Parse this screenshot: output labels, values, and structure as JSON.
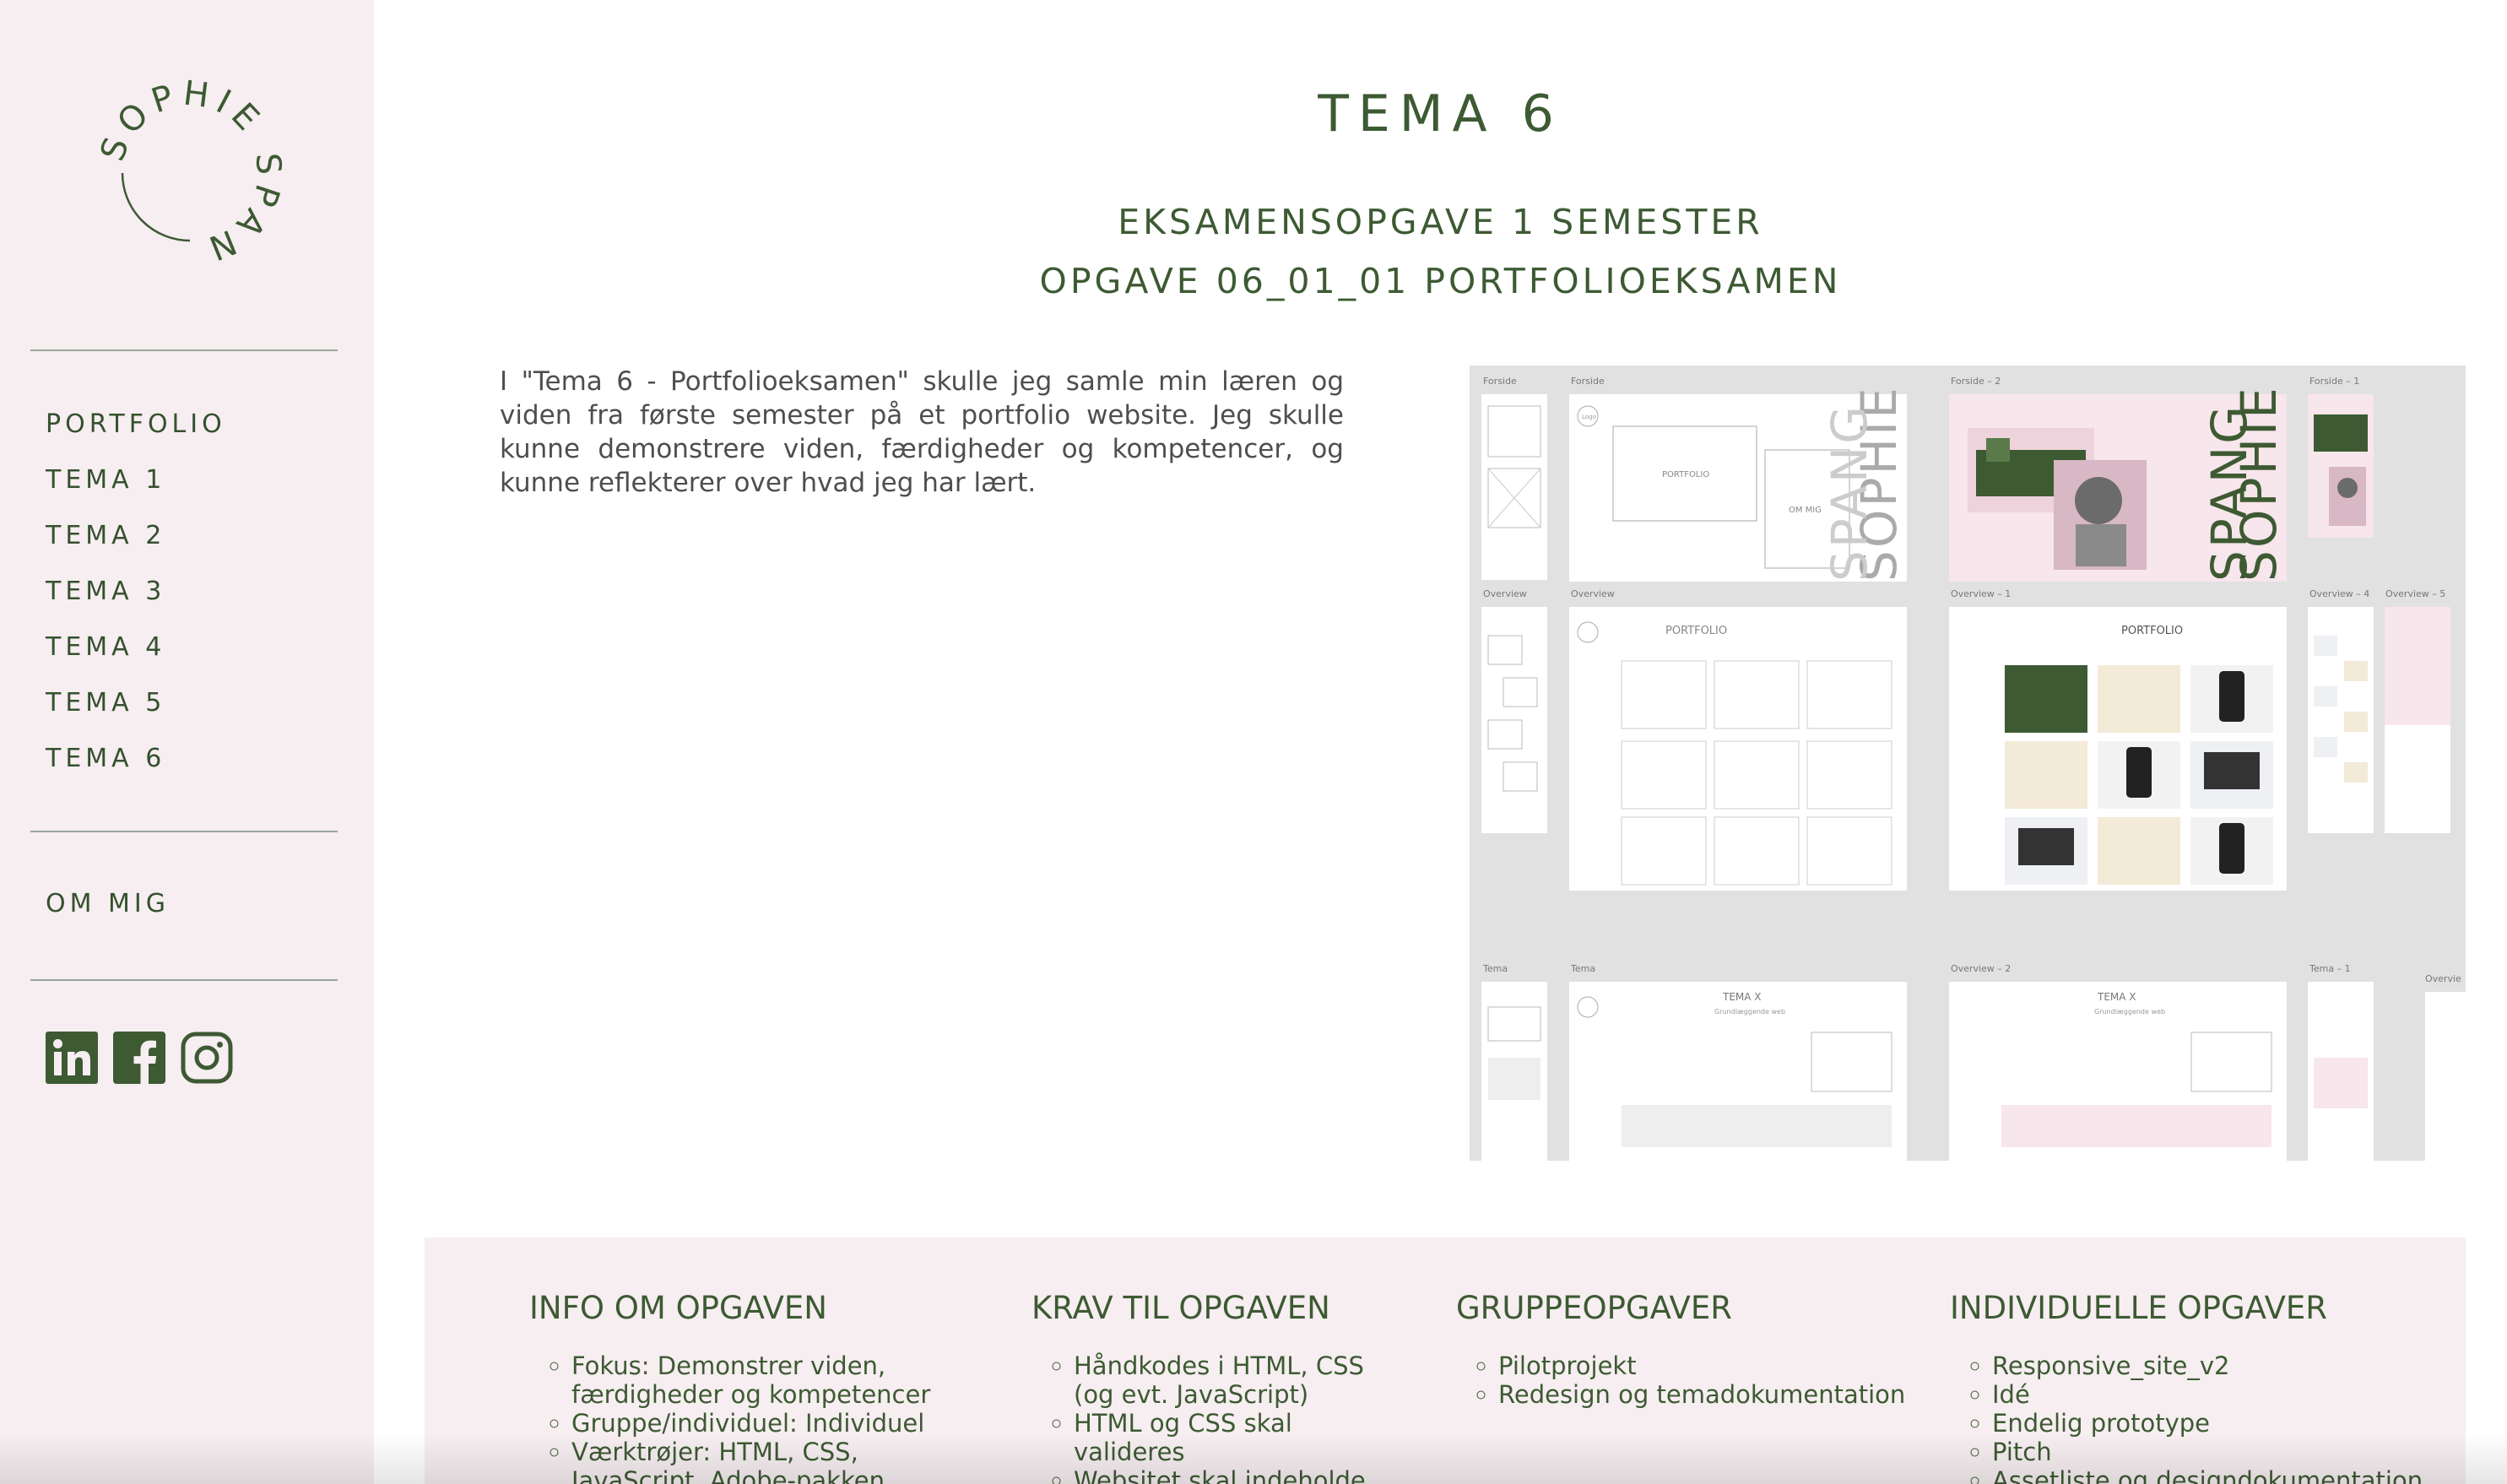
{
  "brand": {
    "name": "SOPHIE SPANG",
    "first": "SOPHIE",
    "last": "SPANG",
    "accent": "#3d5a33",
    "sidebar_bg": "#f6eef0"
  },
  "nav": {
    "items": [
      {
        "label": "PORTFOLIO"
      },
      {
        "label": "TEMA 1"
      },
      {
        "label": "TEMA 2"
      },
      {
        "label": "TEMA 3"
      },
      {
        "label": "TEMA 4"
      },
      {
        "label": "TEMA 5"
      },
      {
        "label": "TEMA 6"
      }
    ],
    "about": "OM MIG"
  },
  "social": [
    {
      "icon": "linkedin-icon"
    },
    {
      "icon": "facebook-icon"
    },
    {
      "icon": "instagram-icon"
    }
  ],
  "page": {
    "title": "TEMA 6",
    "subtitle1": "EKSAMENSOPGAVE 1 SEMESTER",
    "subtitle2": "OPGAVE 06_01_01 PORTFOLIOEKSAMEN",
    "intro": "I \"Tema 6 - Portfolioeksamen\" skulle jeg samle min læren og viden fra første semester på et portfolio website. Jeg skulle kunne demonstrere viden, færdigheder og kompetencer, og kunne reflekterer over hvad jeg har lært."
  },
  "mockup": {
    "frame_labels": [
      "Forside",
      "Forside",
      "Forside – 2",
      "Forside – 1",
      "Overview",
      "Overview",
      "Overview – 1",
      "Overview – 4",
      "Overview – 5",
      "Tema",
      "Tema",
      "Overview – 2",
      "Tema – 1",
      "Overvie"
    ],
    "texts": {
      "portfolio": "PORTFOLIO",
      "om_mig": "OM MIG",
      "logo": "Logo",
      "tema_x": "TEMA X",
      "tema_x_sub": "Grundlæggende web",
      "vertical_a": "SOPHIE",
      "vertical_b": "SPANG"
    }
  },
  "info": {
    "columns": [
      {
        "heading": "INFO OM OPGAVEN",
        "items": [
          "Fokus: Demonstrer viden, færdigheder og kompetencer",
          "Gruppe/individuel: Individuel",
          "Værktrøjer: HTML, CSS, JavaScript, Adobe-pakken"
        ]
      },
      {
        "heading": "KRAV TIL OPGAVEN",
        "items": [
          "Håndkodes i HTML, CSS (og evt. JavaScript)",
          "HTML og CSS skal valideres",
          "Websitet skal indeholde"
        ]
      },
      {
        "heading": "GRUPPEOPGAVER",
        "items": [
          "Pilotprojekt",
          "Redesign og temadokumentation"
        ]
      },
      {
        "heading": "INDIVIDUELLE OPGAVER",
        "items": [
          "Responsive_site_v2",
          "Idé",
          "Endelig prototype",
          "Pitch",
          "Assetliste og designdokumentation"
        ]
      }
    ]
  }
}
